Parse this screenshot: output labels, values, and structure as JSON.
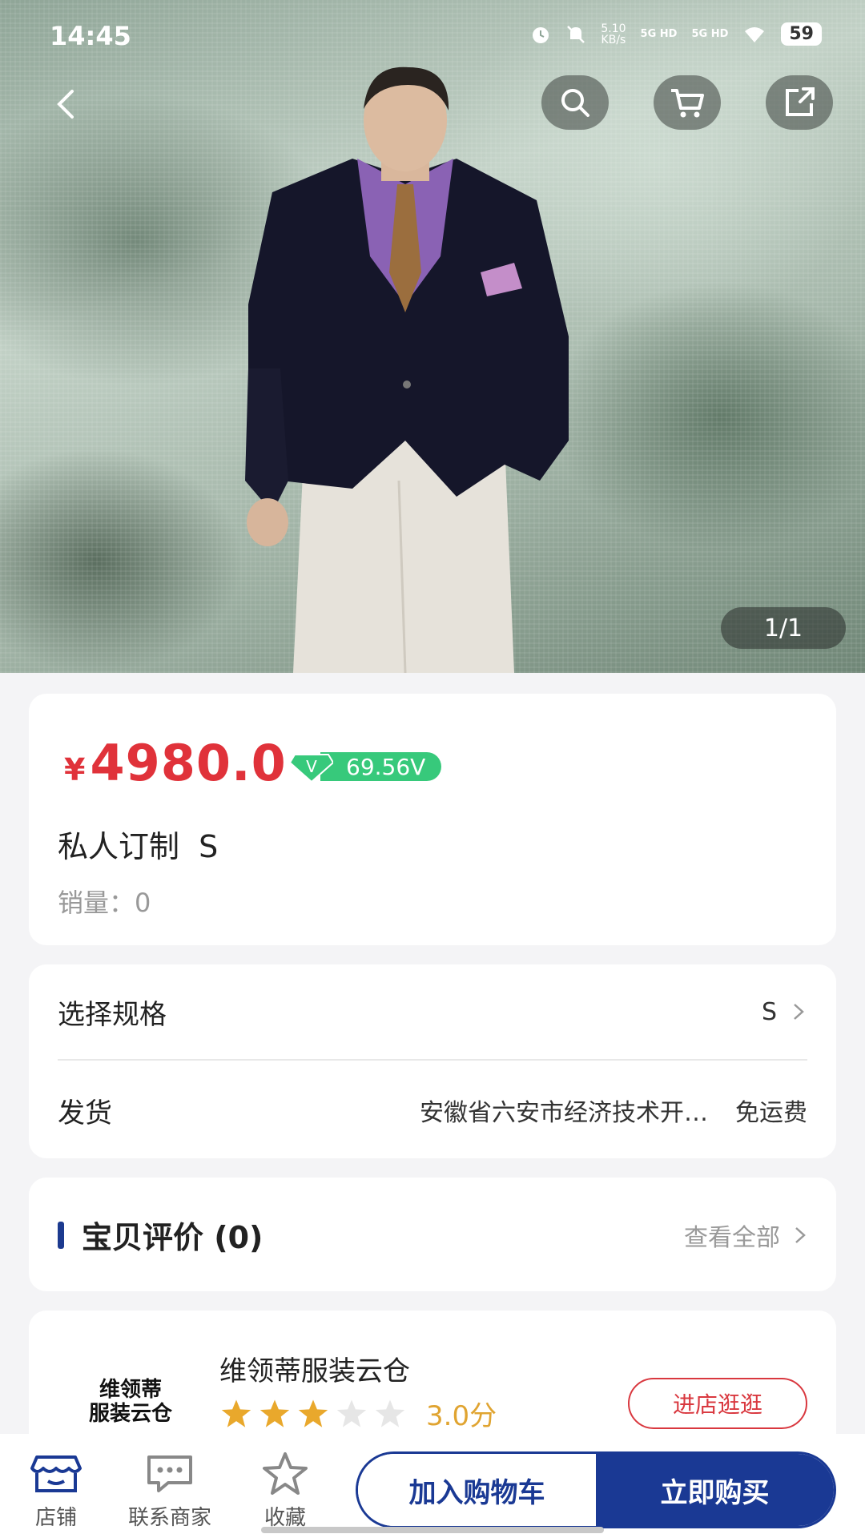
{
  "status_bar": {
    "time": "14:45",
    "net_speed_value": "5.10",
    "net_speed_unit": "KB/s",
    "signal_1": "5G HD",
    "signal_2": "5G HD",
    "battery": "59"
  },
  "hero": {
    "pager": "1/1"
  },
  "product": {
    "currency": "¥",
    "price": "4980.0",
    "v_badge": "V",
    "v_value": "69.56V",
    "title": "私人订制  S",
    "sales_label": "销量：",
    "sales_value": "0"
  },
  "spec": {
    "label": "选择规格",
    "value": "S"
  },
  "shipping": {
    "label": "发货",
    "origin": "安徽省六安市经济技术开…",
    "fee": "免运费"
  },
  "reviews": {
    "title": "宝贝评价 (0)",
    "view_all": "查看全部"
  },
  "store": {
    "logo_line1": "维领蒂",
    "logo_line2": "服装云仓",
    "name": "维领蒂服装云仓",
    "rating": "3.0分",
    "rating_value": 3,
    "rating_max": 5,
    "visit_label": "进店逛逛"
  },
  "bottom_nav": {
    "store": "店铺",
    "contact": "联系商家",
    "favorite": "收藏",
    "add_to_cart": "加入购物车",
    "buy_now": "立即购买"
  },
  "colors": {
    "price": "#e0323a",
    "accent": "#1a3994",
    "v_badge": "#37c97b",
    "star_on": "#e9a82c",
    "star_off": "#e6e6e6"
  }
}
